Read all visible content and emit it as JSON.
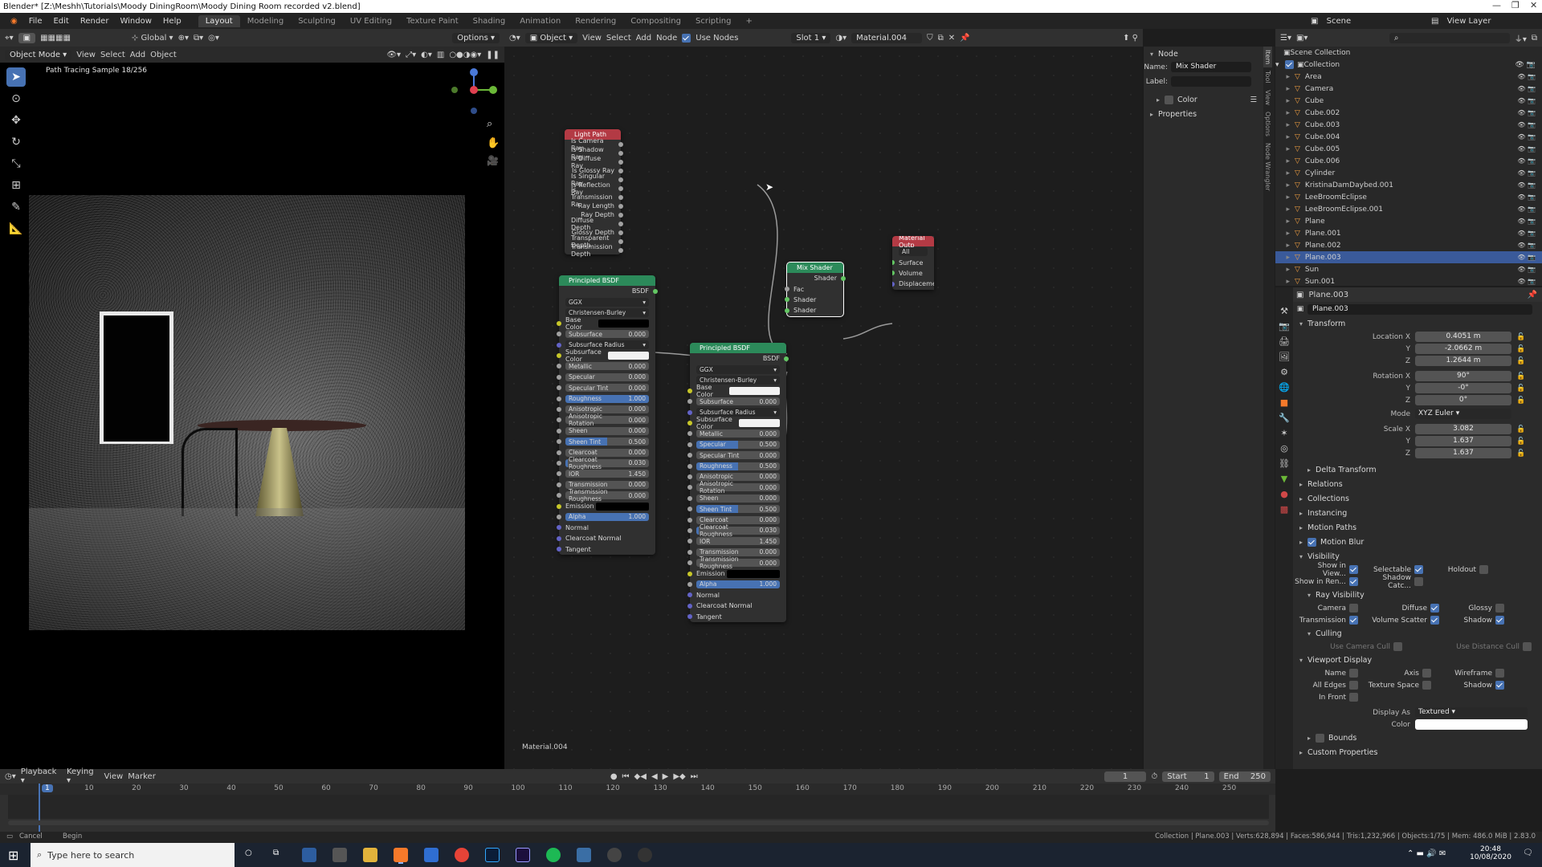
{
  "window": {
    "title": "Blender* [Z:\\Meshh\\Tutorials\\Moody DiningRoom\\Moody Dining Room recorded v2.blend]"
  },
  "menubar": {
    "menus": [
      "File",
      "Edit",
      "Render",
      "Window",
      "Help"
    ],
    "workspaces": [
      "Layout",
      "Modeling",
      "Sculpting",
      "UV Editing",
      "Texture Paint",
      "Shading",
      "Animation",
      "Rendering",
      "Compositing",
      "Scripting"
    ],
    "active_workspace": "Layout",
    "scene": "Scene",
    "view_layer": "View Layer"
  },
  "viewport": {
    "mode": "Object Mode",
    "menus": [
      "View",
      "Select",
      "Add",
      "Object"
    ],
    "transform_orientation": "Global",
    "options": "Options",
    "overlay_text": "Path Tracing Sample 18/256"
  },
  "node_editor": {
    "editor_type": "Object",
    "menus": [
      "View",
      "Select",
      "Add",
      "Node"
    ],
    "use_nodes_label": "Use Nodes",
    "slot": "Slot 1",
    "material": "Material.004",
    "footer_material": "Material.004",
    "light_path": {
      "title": "Light Path",
      "outputs": [
        "Is Camera Ray",
        "Is Shadow Ray",
        "Is Diffuse Ray",
        "Is Glossy Ray",
        "Is Singular Ray",
        "Is Reflection Ray",
        "Is Transmission Ra",
        "Ray Length",
        "Ray Depth",
        "Diffuse Depth",
        "Glossy Depth",
        "Transparent Depth",
        "Transmission Depth"
      ]
    },
    "bsdf1": {
      "title": "Principled BSDF",
      "output": "BSDF",
      "distribution": "GGX",
      "subsurface_method": "Christensen-Burley",
      "inputs": [
        {
          "label": "Base Color",
          "kind": "color",
          "color": "#000000"
        },
        {
          "label": "Subsurface",
          "kind": "value",
          "value": "0.000",
          "fill": 0
        },
        {
          "label": "Subsurface Radius",
          "kind": "drop"
        },
        {
          "label": "Subsurface Color",
          "kind": "color",
          "color": "#f2f2f2"
        },
        {
          "label": "Metallic",
          "kind": "value",
          "value": "0.000",
          "fill": 0
        },
        {
          "label": "Specular",
          "kind": "value",
          "value": "0.000",
          "fill": 0
        },
        {
          "label": "Specular Tint",
          "kind": "value",
          "value": "0.000",
          "fill": 0
        },
        {
          "label": "Roughness",
          "kind": "value",
          "value": "1.000",
          "fill": 1
        },
        {
          "label": "Anisotropic",
          "kind": "value",
          "value": "0.000",
          "fill": 0
        },
        {
          "label": "Anisotropic Rotation",
          "kind": "value",
          "value": "0.000",
          "fill": 0
        },
        {
          "label": "Sheen",
          "kind": "value",
          "value": "0.000",
          "fill": 0
        },
        {
          "label": "Sheen Tint",
          "kind": "value",
          "value": "0.500",
          "fill": 0.5
        },
        {
          "label": "Clearcoat",
          "kind": "value",
          "value": "0.000",
          "fill": 0
        },
        {
          "label": "Clearcoat Roughness",
          "kind": "value",
          "value": "0.030",
          "fill": 0.03
        },
        {
          "label": "IOR",
          "kind": "value",
          "value": "1.450",
          "fill": 0
        },
        {
          "label": "Transmission",
          "kind": "value",
          "value": "0.000",
          "fill": 0
        },
        {
          "label": "Transmission Roughness",
          "kind": "value",
          "value": "0.000",
          "fill": 0
        },
        {
          "label": "Emission",
          "kind": "color",
          "color": "#000000"
        },
        {
          "label": "Alpha",
          "kind": "value",
          "value": "1.000",
          "fill": 1
        },
        {
          "label": "Normal",
          "kind": "socket"
        },
        {
          "label": "Clearcoat Normal",
          "kind": "socket"
        },
        {
          "label": "Tangent",
          "kind": "socket"
        }
      ]
    },
    "bsdf2": {
      "title": "Principled BSDF",
      "output": "BSDF",
      "distribution": "GGX",
      "subsurface_method": "Christensen-Burley",
      "inputs": [
        {
          "label": "Base Color",
          "kind": "color",
          "color": "#f2f2f2"
        },
        {
          "label": "Subsurface",
          "kind": "value",
          "value": "0.000",
          "fill": 0
        },
        {
          "label": "Subsurface Radius",
          "kind": "drop"
        },
        {
          "label": "Subsurface Color",
          "kind": "color",
          "color": "#f2f2f2"
        },
        {
          "label": "Metallic",
          "kind": "value",
          "value": "0.000",
          "fill": 0
        },
        {
          "label": "Specular",
          "kind": "value",
          "value": "0.500",
          "fill": 0.5
        },
        {
          "label": "Specular Tint",
          "kind": "value",
          "value": "0.000",
          "fill": 0
        },
        {
          "label": "Roughness",
          "kind": "value",
          "value": "0.500",
          "fill": 0.5
        },
        {
          "label": "Anisotropic",
          "kind": "value",
          "value": "0.000",
          "fill": 0
        },
        {
          "label": "Anisotropic Rotation",
          "kind": "value",
          "value": "0.000",
          "fill": 0
        },
        {
          "label": "Sheen",
          "kind": "value",
          "value": "0.000",
          "fill": 0
        },
        {
          "label": "Sheen Tint",
          "kind": "value",
          "value": "0.500",
          "fill": 0.5
        },
        {
          "label": "Clearcoat",
          "kind": "value",
          "value": "0.000",
          "fill": 0
        },
        {
          "label": "Clearcoat Roughness",
          "kind": "value",
          "value": "0.030",
          "fill": 0.03
        },
        {
          "label": "IOR",
          "kind": "value",
          "value": "1.450",
          "fill": 0
        },
        {
          "label": "Transmission",
          "kind": "value",
          "value": "0.000",
          "fill": 0
        },
        {
          "label": "Transmission Roughness",
          "kind": "value",
          "value": "0.000",
          "fill": 0
        },
        {
          "label": "Emission",
          "kind": "color",
          "color": "#000000"
        },
        {
          "label": "Alpha",
          "kind": "value",
          "value": "1.000",
          "fill": 1
        },
        {
          "label": "Normal",
          "kind": "socket"
        },
        {
          "label": "Clearcoat Normal",
          "kind": "socket"
        },
        {
          "label": "Tangent",
          "kind": "socket"
        }
      ]
    },
    "mix_shader": {
      "title": "Mix Shader",
      "output": "Shader",
      "inputs": [
        "Fac",
        "Shader",
        "Shader"
      ]
    },
    "material_output": {
      "title": "Material Outp",
      "target": "All",
      "inputs": [
        "Surface",
        "Volume",
        "Displacement"
      ]
    }
  },
  "npanel": {
    "section": "Node",
    "name_label": "Name:",
    "name_value": "Mix Shader",
    "label_label": "Label:",
    "color_label": "Color",
    "properties_label": "Properties",
    "tabs": [
      "Item",
      "Tool",
      "View",
      "Options",
      "Node Wrangler"
    ]
  },
  "outliner": {
    "root": "Scene Collection",
    "collection": "Collection",
    "items": [
      "Area",
      "Camera",
      "Cube",
      "Cube.002",
      "Cube.003",
      "Cube.004",
      "Cube.005",
      "Cube.006",
      "Cylinder",
      "KristinaDamDaybed.001",
      "LeeBroomEclipse",
      "LeeBroomEclipse.001",
      "Plane",
      "Plane.001",
      "Plane.002",
      "Plane.003",
      "Sun",
      "Sun.001"
    ],
    "selected": "Plane.003"
  },
  "properties": {
    "object": "Plane.003",
    "object_name": "Plane.003",
    "transform_title": "Transform",
    "location": {
      "label": "Location X",
      "x": "0.4051 m",
      "y": "-2.0662 m",
      "z": "1.2644 m"
    },
    "rotation": {
      "label": "Rotation X",
      "x": "90°",
      "y": "-0°",
      "z": "0°"
    },
    "mode_label": "Mode",
    "mode": "XYZ Euler",
    "scale": {
      "label": "Scale X",
      "x": "3.082",
      "y": "1.637",
      "z": "1.637"
    },
    "y_label": "Y",
    "z_label": "Z",
    "sections": [
      "Delta Transform",
      "Relations",
      "Collections",
      "Instancing",
      "Motion Paths",
      "Motion Blur",
      "Visibility"
    ],
    "visibility": {
      "show_in_view": "Show in View...",
      "selectable": "Selectable",
      "holdout": "Holdout",
      "show_in_render": "Show in Ren...",
      "shadow_catcher": "Shadow Catc...",
      "ray_visibility": "Ray Visibility",
      "camera": "Camera",
      "diffuse": "Diffuse",
      "glossy": "Glossy",
      "transmission": "Transmission",
      "volume_scatter": "Volume Scatter",
      "shadow": "Shadow",
      "culling": "Culling",
      "use_camera_cull": "Use Camera Cull",
      "use_distance_cull": "Use Distance Cull"
    },
    "viewport_display": {
      "title": "Viewport Display",
      "name": "Name",
      "axis": "Axis",
      "wireframe": "Wireframe",
      "all_edges": "All Edges",
      "texture_space": "Texture Space",
      "shadow": "Shadow",
      "in_front": "In Front",
      "display_as_label": "Display As",
      "display_as": "Textured",
      "color_label": "Color",
      "bounds": "Bounds"
    },
    "custom_properties": "Custom Properties"
  },
  "timeline": {
    "menus": [
      "Playback",
      "Keying",
      "View",
      "Marker"
    ],
    "current_frame": "1",
    "start_label": "Start",
    "start": "1",
    "end_label": "End",
    "end": "250",
    "ticks": [
      "1",
      "10",
      "20",
      "30",
      "40",
      "50",
      "60",
      "70",
      "80",
      "90",
      "100",
      "110",
      "120",
      "130",
      "140",
      "150",
      "160",
      "170",
      "180",
      "190",
      "200",
      "210",
      "220",
      "230",
      "240",
      "250"
    ]
  },
  "statusbar": {
    "left_cancel": "Cancel",
    "left_begin": "Begin",
    "right": "Collection | Plane.003 | Verts:628,894 | Faces:586,944 | Tris:1,232,966 | Objects:1/75 | Mem: 486.0 MiB | 2.83.0"
  },
  "taskbar": {
    "search_placeholder": "Type here to search",
    "time": "20:48",
    "date": "10/08/2020"
  }
}
